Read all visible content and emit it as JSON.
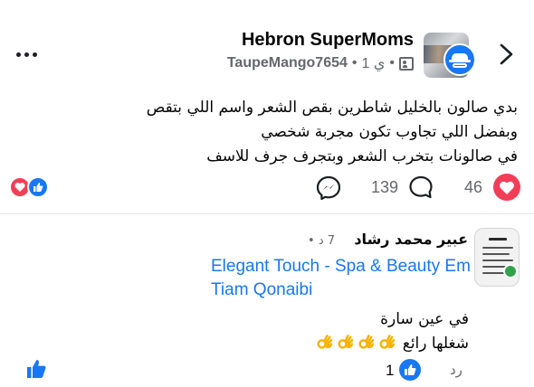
{
  "header": {
    "group_name": "Hebron SuperMoms",
    "author": "TaupeMango7654",
    "time_ago": "1 ي",
    "separator": "•",
    "icons": {
      "more": "more-horizontal-icon",
      "privacy": "group-privacy-icon",
      "forward": "chevron-right-icon"
    }
  },
  "post": {
    "lines": [
      "بدي صالون بالخليل شاطرين بقص الشعر واسم اللي بتقص",
      "وبفضل اللي تجاوب تكون مجربة شخصي",
      "في صالونات بتخرب الشعر وبتجرف جرف للاسف"
    ]
  },
  "stats": {
    "reaction_count": "46",
    "comment_count": "139",
    "reaction_types": [
      "love",
      "like"
    ]
  },
  "comment": {
    "author": "عبير محمد رشاد",
    "time": "7 د",
    "mention": "Elegant Touch - Spa & Beauty Em Tiam Qonaibi",
    "lines": [
      "في عين سارة",
      "شغلها رائع"
    ],
    "emoji_count": 4,
    "like_count": "1",
    "reply_label": "رد"
  },
  "colors": {
    "accent": "#1877f2",
    "love": "#f33e58",
    "online": "#31a24c",
    "secondary_text": "#65676b"
  }
}
